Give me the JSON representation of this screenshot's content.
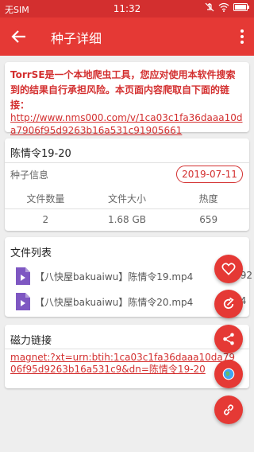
{
  "status_bar": {
    "carrier": "无SIM",
    "time": "11:32"
  },
  "app_bar": {
    "title": "种子详细"
  },
  "notice": {
    "disclaimer": "TorrSE是一个本地爬虫工具，您应对使用本软件搜索到的结果自行承担风险。本页面内容爬取自下面的链接：",
    "source_link": "http://www.nms000.com/v/1ca03c1fa36daaa10da7906f95d9263b16a531c91905661"
  },
  "torrent": {
    "name": "陈情令19-20",
    "info_label": "种子信息",
    "date": "2019-07-11",
    "columns": [
      "文件数量",
      "文件大小",
      "热度"
    ],
    "values": [
      "2",
      "1.68 GB",
      "659"
    ]
  },
  "files": {
    "title": "文件列表",
    "items": [
      {
        "name": "【八快屋bakuaiwu】陈情令19.mp4",
        "size": "889.92"
      },
      {
        "name": "【八快屋bakuaiwu】陈情令20.mp4",
        "size": "832.4"
      }
    ]
  },
  "magnet": {
    "title": "磁力链接",
    "link": "magnet:?xt=urn:btih:1ca03c1fa36daaa10da7906f95d9263b16a531c9&dn=陈情令19-20"
  },
  "fabs": [
    "favorite-icon",
    "refresh-icon",
    "share-icon",
    "browser-icon",
    "link-icon"
  ],
  "colors": {
    "primary": "#e53935",
    "primary_dark": "#d32f2f",
    "background": "#eeeeee"
  }
}
